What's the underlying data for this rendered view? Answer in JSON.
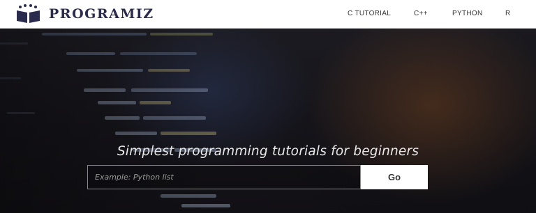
{
  "header": {
    "logo_text": "PROGRAMIZ",
    "nav": [
      {
        "label": "C TUTORIAL"
      },
      {
        "label": "C++"
      },
      {
        "label": "PYTHON"
      },
      {
        "label": "R"
      }
    ]
  },
  "hero": {
    "tagline": "Simplest programming tutorials for beginners",
    "search": {
      "placeholder": "Example: Python list",
      "value": ""
    },
    "go_label": "Go"
  },
  "colors": {
    "brand": "#2b2b4e",
    "hero_bg": "#16151b",
    "button_bg": "#ffffff"
  }
}
